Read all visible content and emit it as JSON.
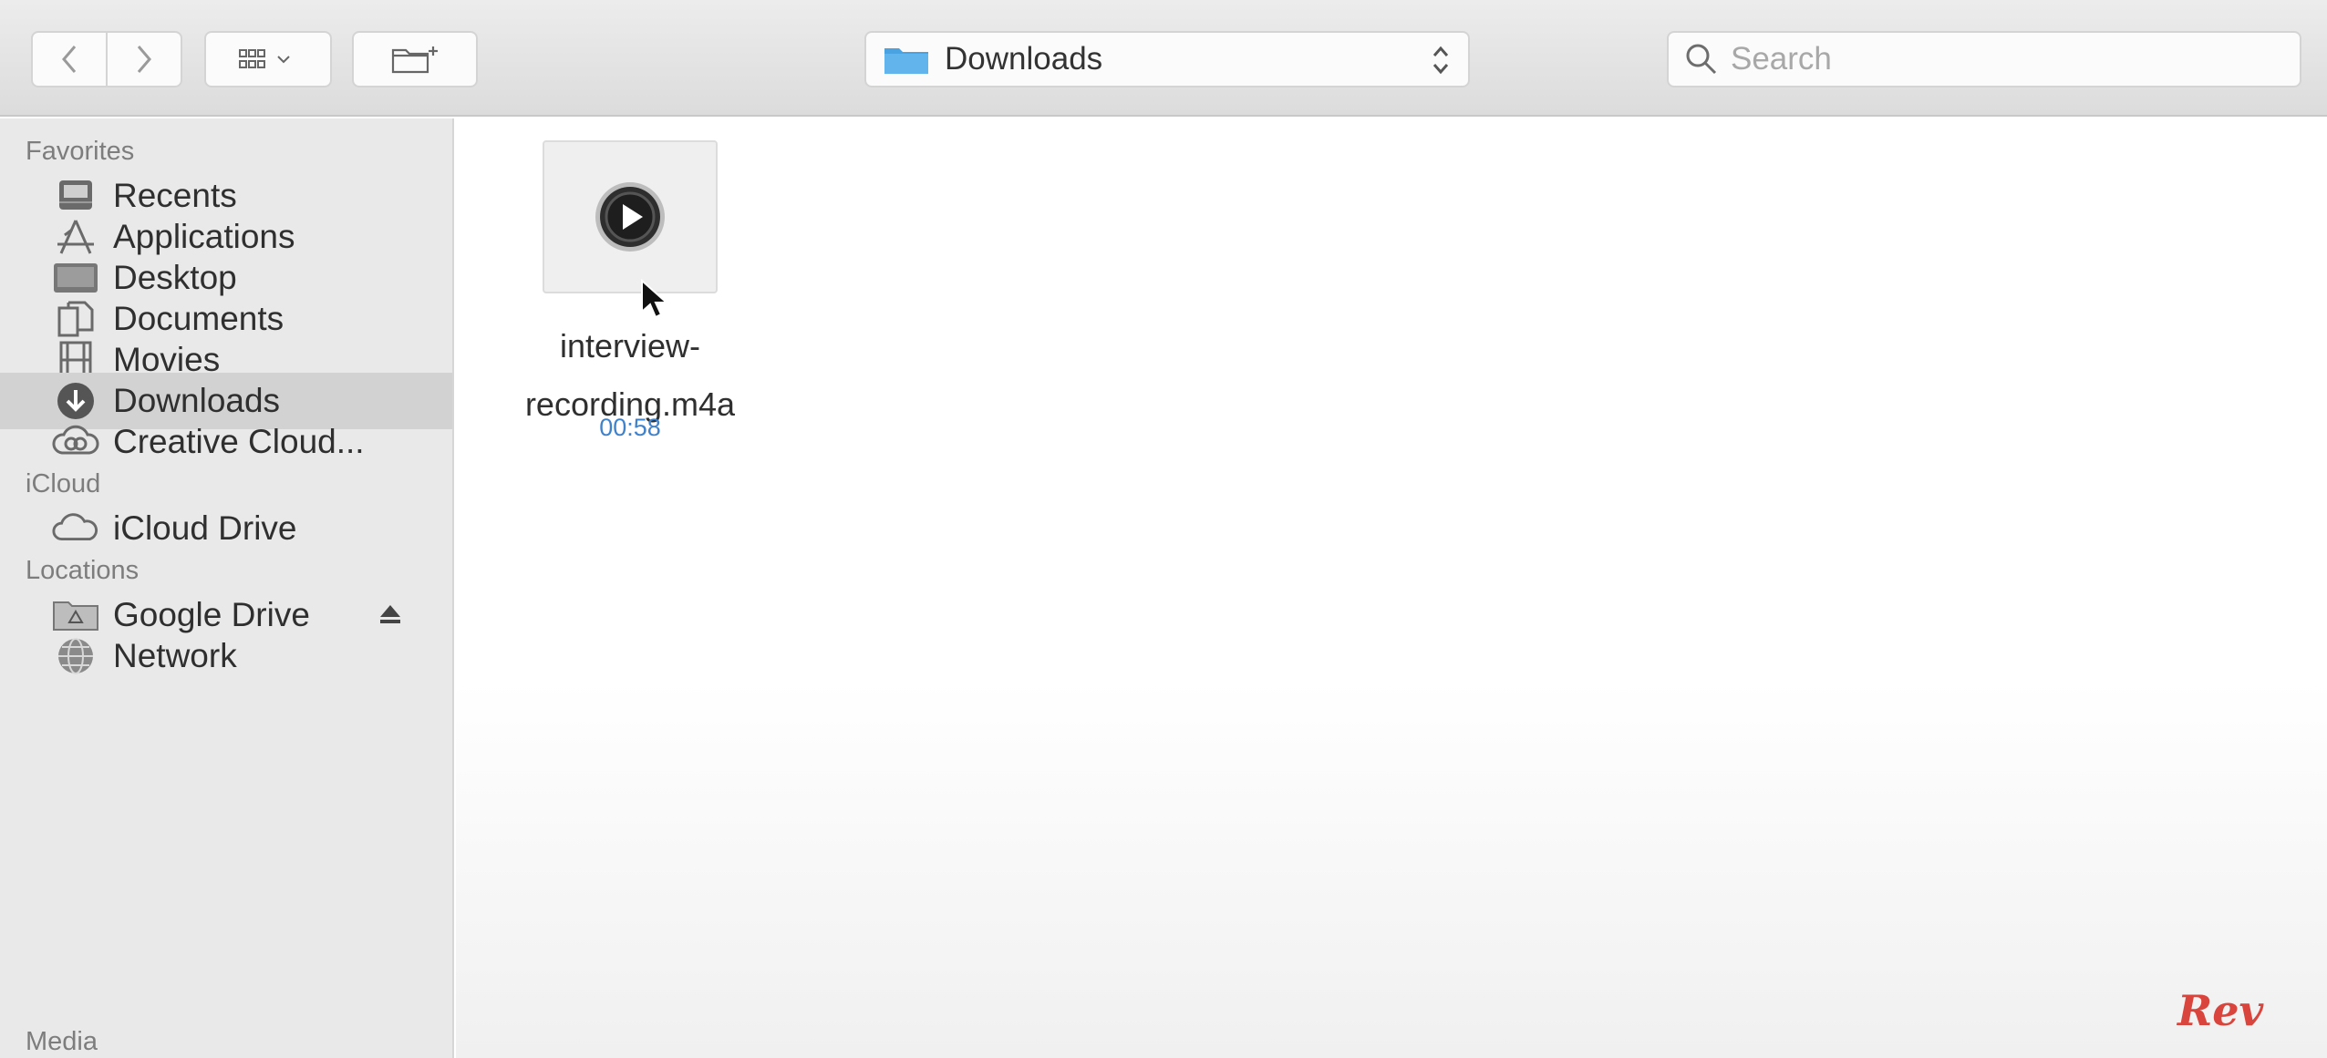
{
  "toolbar": {
    "back_icon": "chevron-left-icon",
    "forward_icon": "chevron-right-icon",
    "view_icon": "icon-grid-icon",
    "new_folder_icon": "new-folder-icon",
    "path": {
      "label": "Downloads",
      "icon": "folder-icon"
    },
    "search": {
      "placeholder": "Search",
      "value": ""
    }
  },
  "sidebar": {
    "sections": [
      {
        "title": "Favorites",
        "items": [
          {
            "label": "Recents",
            "icon": "recents-icon"
          },
          {
            "label": "Applications",
            "icon": "applications-icon"
          },
          {
            "label": "Desktop",
            "icon": "desktop-icon"
          },
          {
            "label": "Documents",
            "icon": "documents-icon"
          },
          {
            "label": "Movies",
            "icon": "movies-icon"
          },
          {
            "label": "Downloads",
            "icon": "downloads-icon",
            "selected": true
          },
          {
            "label": "Creative Cloud...",
            "icon": "creative-cloud-icon"
          }
        ]
      },
      {
        "title": "iCloud",
        "items": [
          {
            "label": "iCloud Drive",
            "icon": "cloud-icon"
          }
        ]
      },
      {
        "title": "Locations",
        "items": [
          {
            "label": "Google Drive",
            "icon": "google-drive-icon",
            "eject": true
          },
          {
            "label": "Network",
            "icon": "network-icon"
          }
        ]
      },
      {
        "title": "Media",
        "items": []
      }
    ]
  },
  "files": [
    {
      "name": "interview-recording.m4a",
      "duration": "00:58",
      "icon": "audio-file-icon"
    }
  ],
  "watermark": "Rev",
  "colors": {
    "selection": "#d2d2d2",
    "duration": "#3f82cc",
    "watermark": "#d9453c",
    "folder": "#4aa3e0"
  }
}
